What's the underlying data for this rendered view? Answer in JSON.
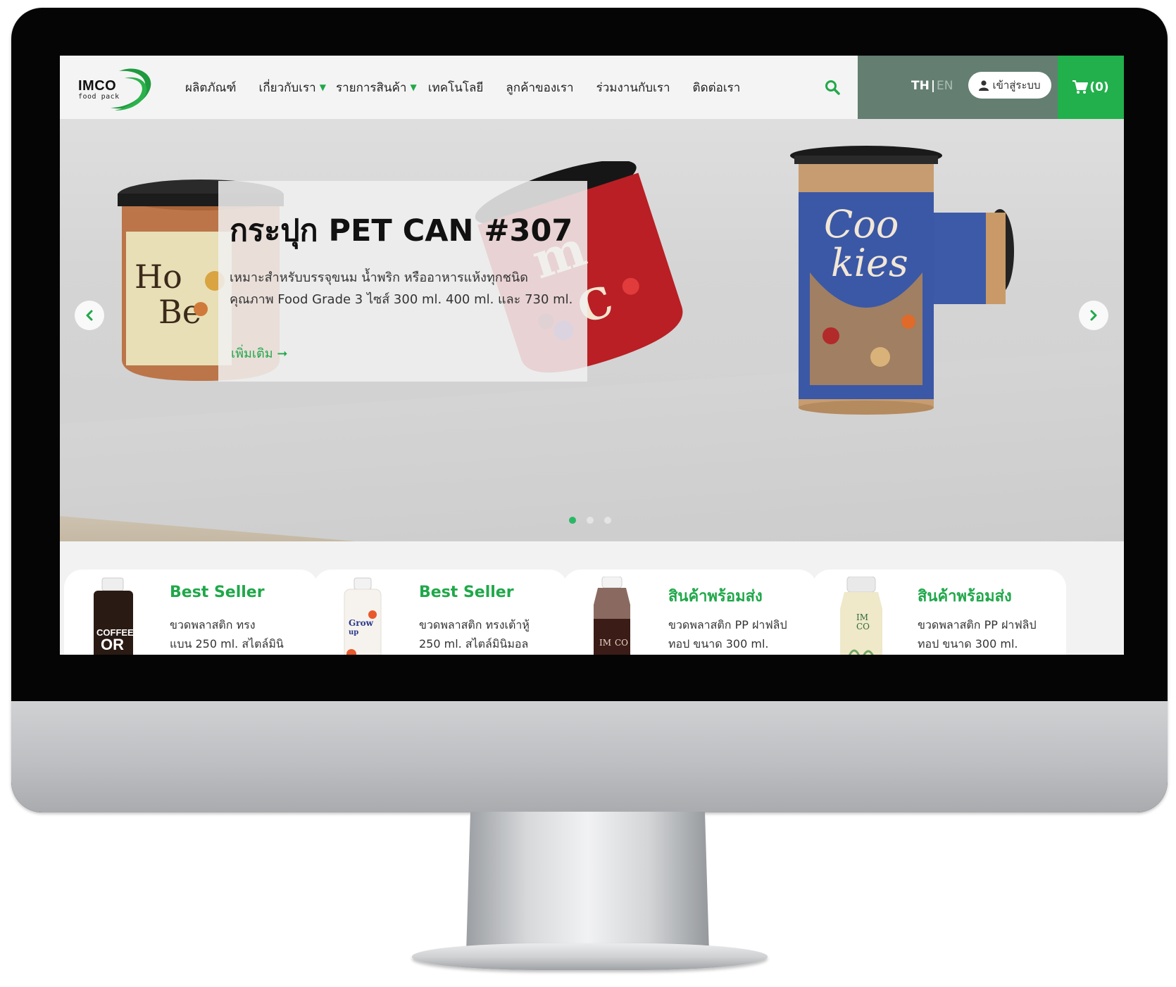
{
  "header": {
    "logo_word": "IMCO",
    "logo_sub": "food pack",
    "nav": [
      {
        "label": "ผลิตภัณฑ์",
        "dropdown": false
      },
      {
        "label": "เกี่ยวกับเรา",
        "dropdown": true
      },
      {
        "label": "รายการสินค้า",
        "dropdown": true
      },
      {
        "label": "เทคโนโลยี",
        "dropdown": false
      },
      {
        "label": "ลูกค้าของเรา",
        "dropdown": false
      },
      {
        "label": "ร่วมงานกับเรา",
        "dropdown": false
      },
      {
        "label": "ติดต่อเรา",
        "dropdown": false
      }
    ],
    "search_icon": "search-icon",
    "lang_th": "TH",
    "lang_sep": "|",
    "lang_en": "EN",
    "login_label": "เข้าสู่ระบบ",
    "cart_count": "(0)"
  },
  "hero": {
    "title": "กระปุก PET CAN #307",
    "desc_line1": "เหมาะสำหรับบรรจุขนม น้ำพริก หรืออาหารแห้งทุกชนิด",
    "desc_line2": "คุณภาพ Food Grade 3 ไซส์ 300 ml. 400 ml. และ 730 ml.",
    "more_label": "เพิ่มเติม",
    "slide_count": 3,
    "active_slide": 1
  },
  "products": [
    {
      "title": "Best Seller",
      "line1": "ขวดพลาสติก ทรง",
      "line2": "แบน 250 ml. สไตล์มินิ",
      "thumb_text1": "COFFEE",
      "thumb_text2": "OR"
    },
    {
      "title": "Best Seller",
      "line1": "ขวดพลาสติก ทรงเต้าหู้",
      "line2": "250 ml. สไตล์มินิมอล",
      "thumb_text1": "Grow",
      "thumb_text2": "up"
    },
    {
      "title": "สินค้าพร้อมส่ง",
      "line1": "ขวดพลาสติก PP ฝาฟลิป",
      "line2": "ทอป ขนาด 300 ml.",
      "thumb_text1": "IM",
      "thumb_text2": "CO"
    },
    {
      "title": "สินค้าพร้อมส่ง",
      "line1": "ขวดพลาสติก PP ฝาฟลิป",
      "line2": "ทอป ขนาด 300 ml.",
      "thumb_text1": "IM",
      "thumb_text2": "CO"
    }
  ],
  "colors": {
    "brand_green": "#21b04b",
    "account_bar": "#647e72"
  }
}
